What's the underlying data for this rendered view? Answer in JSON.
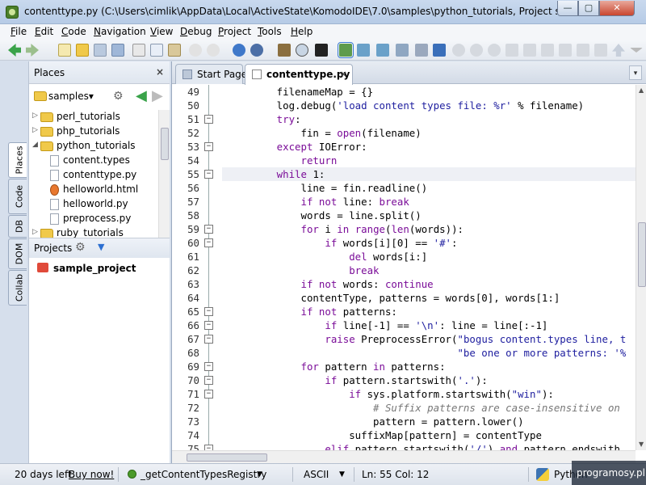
{
  "window": {
    "title": "contenttype.py (C:\\Users\\cimlik\\AppData\\Local\\ActiveState\\KomodoIDE\\7.0\\samples\\python_tutorials, Project sample_proj...",
    "minimize": "—",
    "maximize": "▢",
    "close": "✕"
  },
  "menu": [
    "File",
    "Edit",
    "Code",
    "Navigation",
    "View",
    "Debug",
    "Project",
    "Tools",
    "Help"
  ],
  "side_tabs": [
    "Places",
    "Code",
    "DB",
    "DOM",
    "Collab"
  ],
  "places": {
    "title": "Places",
    "close": "×",
    "root": "samples",
    "root_caret": "▾",
    "tree": [
      {
        "label": "perl_tutorials",
        "type": "folder",
        "expanded": false
      },
      {
        "label": "php_tutorials",
        "type": "folder",
        "expanded": false
      },
      {
        "label": "python_tutorials",
        "type": "folder",
        "expanded": true
      },
      {
        "label": "content.types",
        "type": "file"
      },
      {
        "label": "contenttype.py",
        "type": "file"
      },
      {
        "label": "helloworld.html",
        "type": "file"
      },
      {
        "label": "helloworld.py",
        "type": "file"
      },
      {
        "label": "preprocess.py",
        "type": "file"
      },
      {
        "label": "ruby_tutorials",
        "type": "folder",
        "expanded": false
      }
    ]
  },
  "projects": {
    "title": "Projects",
    "items": [
      "sample_project"
    ]
  },
  "editor": {
    "tabs": [
      {
        "label": "Start Page",
        "active": false
      },
      {
        "label": "contenttype.py",
        "active": true
      }
    ],
    "tab_close": "×",
    "tab_dropdown": "▾",
    "current_line": 55,
    "lines": [
      {
        "n": "49",
        "t": [
          [
            "i",
            "        filenameMap = {}"
          ]
        ]
      },
      {
        "n": "50",
        "t": [
          [
            "i",
            "        log.debug("
          ],
          [
            "s",
            "'load content types file: %r'"
          ],
          [
            "i",
            " % filename)"
          ]
        ]
      },
      {
        "n": "51",
        "t": [
          [
            "k",
            "        try"
          ],
          [
            "i",
            ":"
          ]
        ],
        "fold": true
      },
      {
        "n": "52",
        "t": [
          [
            "i",
            "            fin = "
          ],
          [
            "k",
            "open"
          ],
          [
            "i",
            "(filename)"
          ]
        ]
      },
      {
        "n": "53",
        "t": [
          [
            "k",
            "        except"
          ],
          [
            "i",
            " IOError:"
          ]
        ],
        "fold": true
      },
      {
        "n": "54",
        "t": [
          [
            "k",
            "            return"
          ]
        ]
      },
      {
        "n": "55",
        "t": [
          [
            "k",
            "        while"
          ],
          [
            "i",
            " 1:"
          ]
        ],
        "fold": true
      },
      {
        "n": "56",
        "t": [
          [
            "i",
            "            line = fin.readline()"
          ]
        ]
      },
      {
        "n": "57",
        "t": [
          [
            "k",
            "            if not"
          ],
          [
            "i",
            " line: "
          ],
          [
            "k",
            "break"
          ]
        ]
      },
      {
        "n": "58",
        "t": [
          [
            "i",
            "            words = line.split()"
          ]
        ]
      },
      {
        "n": "59",
        "t": [
          [
            "k",
            "            for"
          ],
          [
            "i",
            " i "
          ],
          [
            "k",
            "in"
          ],
          [
            "i",
            " "
          ],
          [
            "k",
            "range"
          ],
          [
            "i",
            "("
          ],
          [
            "k",
            "len"
          ],
          [
            "i",
            "(words)):"
          ]
        ],
        "fold": true
      },
      {
        "n": "60",
        "t": [
          [
            "k",
            "                if"
          ],
          [
            "i",
            " words[i][0] == "
          ],
          [
            "s",
            "'#'"
          ],
          [
            "i",
            ":"
          ]
        ],
        "fold": true
      },
      {
        "n": "61",
        "t": [
          [
            "k",
            "                    del"
          ],
          [
            "i",
            " words[i:]"
          ]
        ]
      },
      {
        "n": "62",
        "t": [
          [
            "k",
            "                    break"
          ]
        ]
      },
      {
        "n": "63",
        "t": [
          [
            "k",
            "            if not"
          ],
          [
            "i",
            " words: "
          ],
          [
            "k",
            "continue"
          ]
        ]
      },
      {
        "n": "64",
        "t": [
          [
            "i",
            "            contentType, patterns = words[0], words[1:]"
          ]
        ]
      },
      {
        "n": "65",
        "t": [
          [
            "k",
            "            if not"
          ],
          [
            "i",
            " patterns:"
          ]
        ],
        "fold": true
      },
      {
        "n": "66",
        "t": [
          [
            "k",
            "                if"
          ],
          [
            "i",
            " line[-1] == "
          ],
          [
            "s",
            "'\\n'"
          ],
          [
            "i",
            ": line = line[:-1]"
          ]
        ],
        "fold": true
      },
      {
        "n": "67",
        "t": [
          [
            "k",
            "                raise"
          ],
          [
            "i",
            " PreprocessError("
          ],
          [
            "s",
            "\"bogus content.types line, t"
          ]
        ],
        "fold": true
      },
      {
        "n": "68",
        "t": [
          [
            "s",
            "                                      \"be one or more patterns: '%"
          ]
        ]
      },
      {
        "n": "69",
        "t": [
          [
            "k",
            "            for"
          ],
          [
            "i",
            " pattern "
          ],
          [
            "k",
            "in"
          ],
          [
            "i",
            " patterns:"
          ]
        ],
        "fold": true
      },
      {
        "n": "70",
        "t": [
          [
            "k",
            "                if"
          ],
          [
            "i",
            " pattern.startswith("
          ],
          [
            "s",
            "'.'"
          ],
          [
            "i",
            "):"
          ]
        ],
        "fold": true
      },
      {
        "n": "71",
        "t": [
          [
            "k",
            "                    if"
          ],
          [
            "i",
            " sys.platform.startswith("
          ],
          [
            "s",
            "\"win\""
          ],
          [
            "i",
            "):"
          ]
        ],
        "fold": true
      },
      {
        "n": "72",
        "t": [
          [
            "c",
            "                        # Suffix patterns are case-insensitive on"
          ]
        ]
      },
      {
        "n": "73",
        "t": [
          [
            "i",
            "                        pattern = pattern.lower()"
          ]
        ]
      },
      {
        "n": "74",
        "t": [
          [
            "i",
            "                    suffixMap[pattern] = contentType"
          ]
        ]
      },
      {
        "n": "75",
        "t": [
          [
            "k",
            "                elif"
          ],
          [
            "i",
            " pattern.startswith("
          ],
          [
            "s",
            "'/'"
          ],
          [
            "i",
            ") "
          ],
          [
            "k",
            "and"
          ],
          [
            "i",
            " pattern.endswith"
          ]
        ],
        "fold": true
      }
    ]
  },
  "status": {
    "trial": "20 days left.",
    "buy": "Buy now!",
    "function": "_getContentTypesRegistry",
    "encoding": "ASCII",
    "position": "Ln: 55 Col: 12",
    "language": "Python"
  },
  "watermark": "programosy.pl",
  "colors": {
    "keyword": "#7a0c98",
    "string": "#2020a0",
    "comment": "#777777",
    "folder": "#f0c94a",
    "accent": "#3b7bd4"
  }
}
